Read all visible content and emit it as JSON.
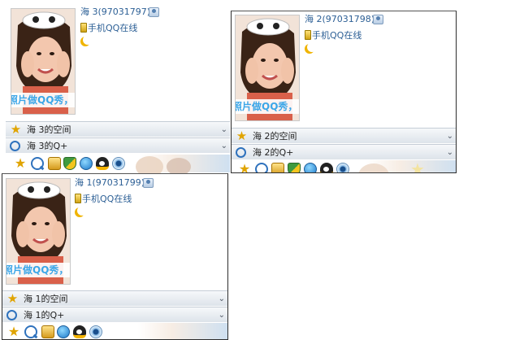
{
  "colors": {
    "nickname_text": "#2c5f95",
    "promo_text": "#3ba6e8",
    "bar_gradient_top": "#f6f8fa",
    "bar_gradient_bottom": "#dde3ea"
  },
  "cards": [
    {
      "nickname": "海 3(97031797)",
      "status_text": "手机QQ在线",
      "photo_caption": "照片做QQ秀，",
      "space_label": "海 3的空间",
      "qplus_label": "海 3的Q+",
      "icons": {
        "card": "contact-card-icon",
        "phone": "mobile-phone-icon",
        "moon": "crescent-moon-icon"
      }
    },
    {
      "nickname": "海 2(97031798)",
      "status_text": "手机QQ在线",
      "photo_caption": "照片做QQ秀，",
      "space_label": "海 2的空间",
      "qplus_label": "海 2的Q+",
      "icons": {
        "card": "contact-card-icon",
        "phone": "mobile-phone-icon",
        "moon": "crescent-moon-icon"
      }
    },
    {
      "nickname": "海 1(97031799)",
      "status_text": "手机QQ在线",
      "photo_caption": "照片做QQ秀，",
      "space_label": "海 1的空间",
      "qplus_label": "海 1的Q+",
      "icons": {
        "card": "contact-card-icon",
        "phone": "mobile-phone-icon",
        "moon": "crescent-moon-icon"
      }
    }
  ],
  "toolbar_icons": [
    "star-icon",
    "qplus-icon",
    "notebook-icon",
    "shield-icon",
    "globe-icon",
    "penguin-icon",
    "eye-icon"
  ],
  "bar_icons": {
    "space": "star-icon",
    "qplus": "qplus-icon",
    "expand": "chevron-down-icon"
  },
  "chevron_glyph": "⌄"
}
